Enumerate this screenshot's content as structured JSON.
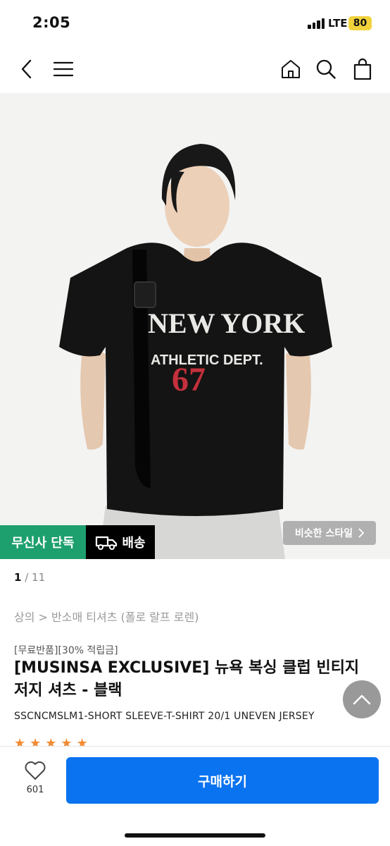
{
  "status_bar": {
    "time": "2:05",
    "network": "LTE",
    "battery": "80"
  },
  "nav": {
    "icons": [
      "back-icon",
      "menu-icon",
      "home-icon",
      "search-icon",
      "shopping-bag-icon"
    ]
  },
  "hero": {
    "shirt_text_line1": "NEW YORK",
    "shirt_text_line2": "ATHLETIC DEPT.",
    "shirt_number": "67",
    "badge_exclusive": "무신사 단독",
    "badge_delivery": "배송",
    "similar_style": "비슷한 스타일"
  },
  "pager": {
    "current": "1",
    "separator": " / ",
    "total": "11"
  },
  "breadcrumb": "상의 > 반소매 티셔츠 (폴로 랄프 로렌)",
  "promo": "[무료반품][30% 적립금]",
  "product": {
    "title_line1": "[MUSINSA EXCLUSIVE] 뉴욕 복싱 클럽 빈티지",
    "title_line2": "저지 셔츠 - 블랙",
    "model": "SSCNCMSLM1-SHORT SLEEVE-T-SHIRT 20/1 UNEVEN JERSEY"
  },
  "bottom_bar": {
    "like_count": "601",
    "buy_label": "구매하기"
  },
  "colors": {
    "accent": "#0a73f0",
    "exclusive": "#1e9f6e",
    "rating": "#f28b33"
  }
}
